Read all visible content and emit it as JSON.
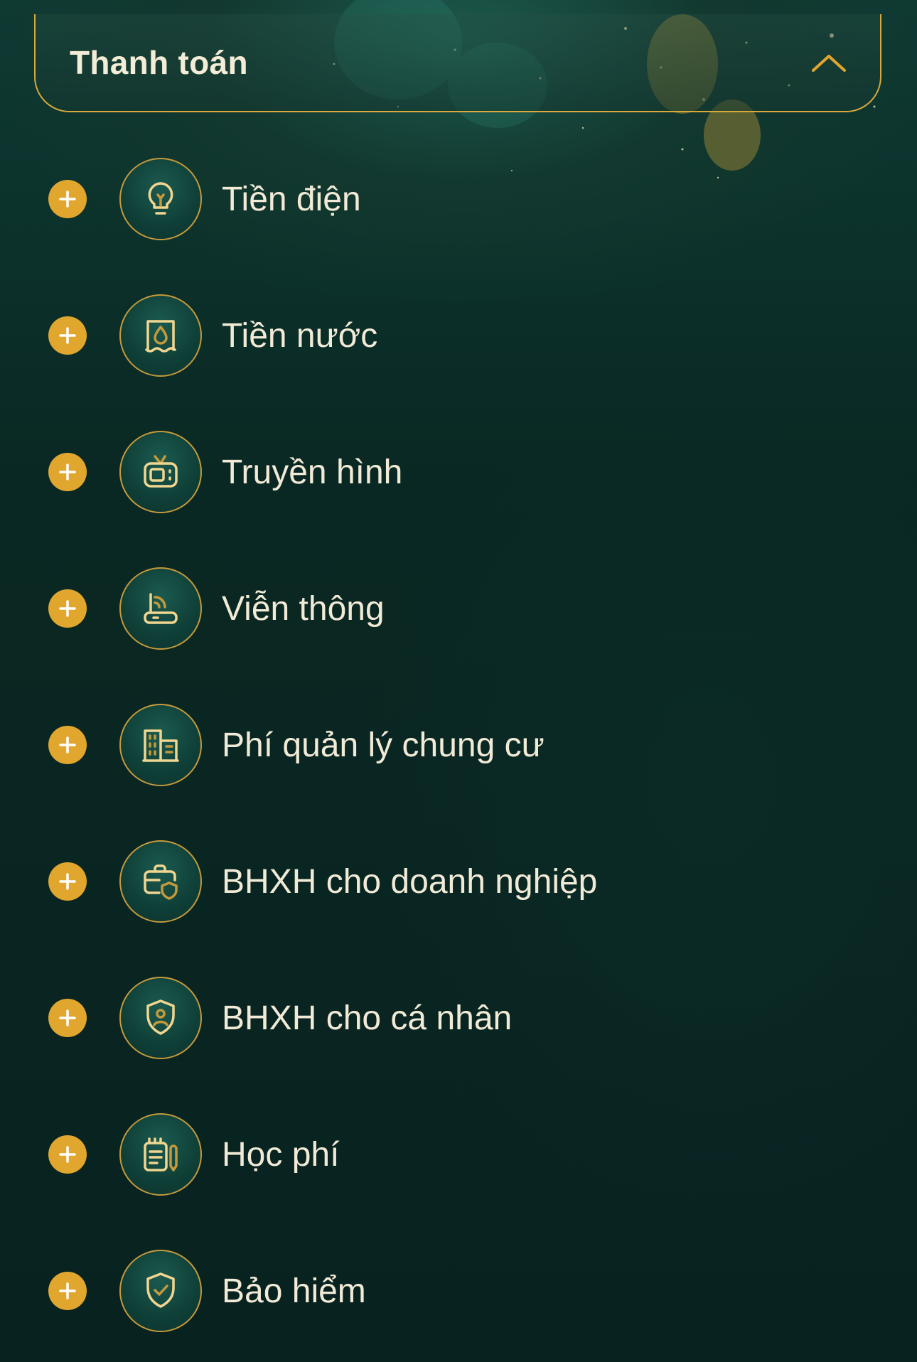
{
  "header": {
    "title": "Thanh toán",
    "collapse_icon": "chevron-up-icon"
  },
  "colors": {
    "accent": "#e0a62e",
    "border": "#d9a93a",
    "text": "#f1ead6"
  },
  "items": [
    {
      "label": "Tiền điện",
      "icon": "lightbulb-icon"
    },
    {
      "label": "Tiền nước",
      "icon": "water-drop-icon"
    },
    {
      "label": "Truyền hình",
      "icon": "tv-icon"
    },
    {
      "label": "Viễn thông",
      "icon": "router-icon"
    },
    {
      "label": "Phí quản lý chung cư",
      "icon": "building-icon"
    },
    {
      "label": "BHXH cho doanh nghiệp",
      "icon": "briefcase-shield-icon"
    },
    {
      "label": "BHXH cho cá nhân",
      "icon": "person-shield-icon"
    },
    {
      "label": "Học phí",
      "icon": "notebook-pencil-icon"
    },
    {
      "label": "Bảo hiểm",
      "icon": "shield-check-icon"
    }
  ]
}
